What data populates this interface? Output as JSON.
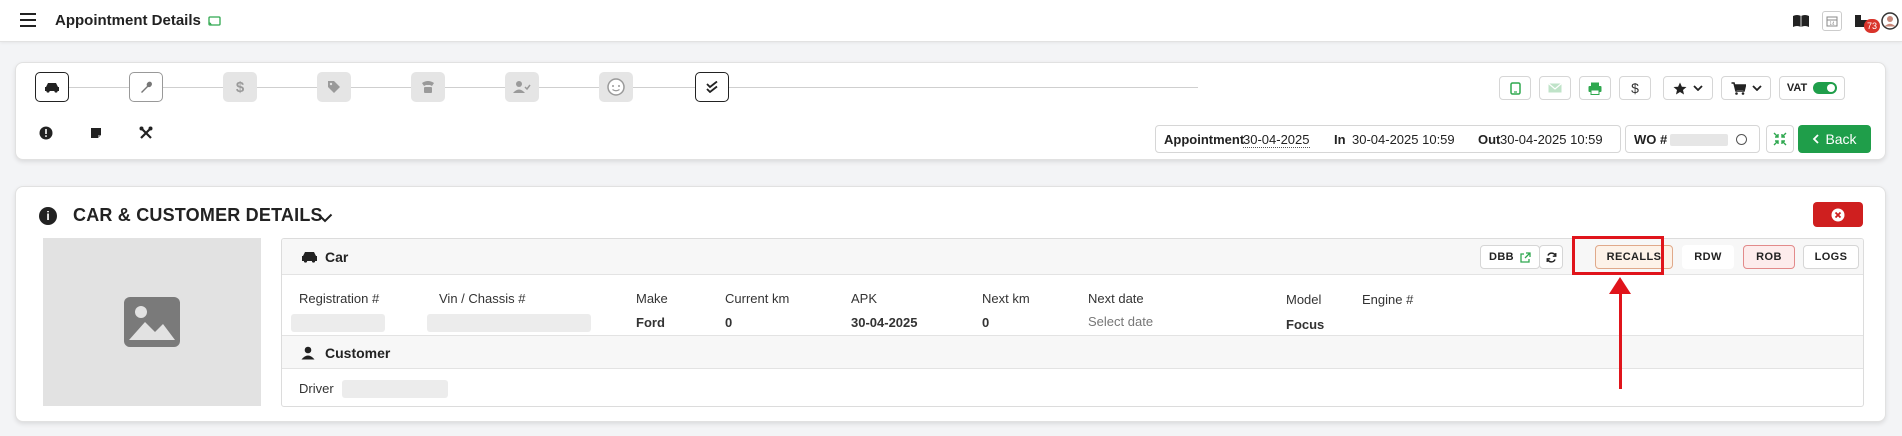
{
  "header": {
    "title": "Appointment Details",
    "notification_count": "73",
    "icons": [
      "menu-icon",
      "cast-icon",
      "book-icon",
      "calendar-icon",
      "notifications-icon",
      "user-avatar-icon"
    ]
  },
  "steps": [
    {
      "name": "car-icon",
      "state": "active"
    },
    {
      "name": "wrench-icon",
      "state": "outlined"
    },
    {
      "name": "dollar-icon",
      "state": "disabled"
    },
    {
      "name": "tag-icon",
      "state": "disabled"
    },
    {
      "name": "phone-icon",
      "state": "disabled"
    },
    {
      "name": "user-check-icon",
      "state": "disabled"
    },
    {
      "name": "face-icon",
      "state": "disabled"
    },
    {
      "name": "checklist-icon",
      "state": "active"
    }
  ],
  "toolbar": {
    "vat_label": "VAT",
    "vat_on": true
  },
  "dates": {
    "appointment_label": "Appointment",
    "appointment_value": "30-04-2025",
    "in_label": "In",
    "in_value": "30-04-2025 10:59",
    "out_label": "Out",
    "out_value": "30-04-2025 10:59"
  },
  "wo": {
    "label": "WO #"
  },
  "back_label": "Back",
  "details": {
    "title": "CAR & CUSTOMER DETAILS",
    "car_header": "Car",
    "customer_header": "Customer",
    "buttons": {
      "dbb": "DBB",
      "recalls": "RECALLS",
      "rdw": "RDW",
      "rob": "ROB",
      "logs": "LOGS"
    },
    "fields": {
      "registration_label": "Registration #",
      "vin_label": "Vin / Chassis #",
      "make_label": "Make",
      "make_value": "Ford",
      "current_km_label": "Current km",
      "current_km_value": "0",
      "apk_label": "APK",
      "apk_value": "30-04-2025",
      "next_km_label": "Next km",
      "next_km_value": "0",
      "next_date_label": "Next date",
      "next_date_placeholder": "Select date",
      "model_label": "Model",
      "model_value": "Focus",
      "engine_label": "Engine #"
    },
    "driver_label": "Driver"
  },
  "colors": {
    "accent_green": "#1f9e4a",
    "danger_red": "#cf1f1f",
    "annotation_red": "#e0141b"
  }
}
